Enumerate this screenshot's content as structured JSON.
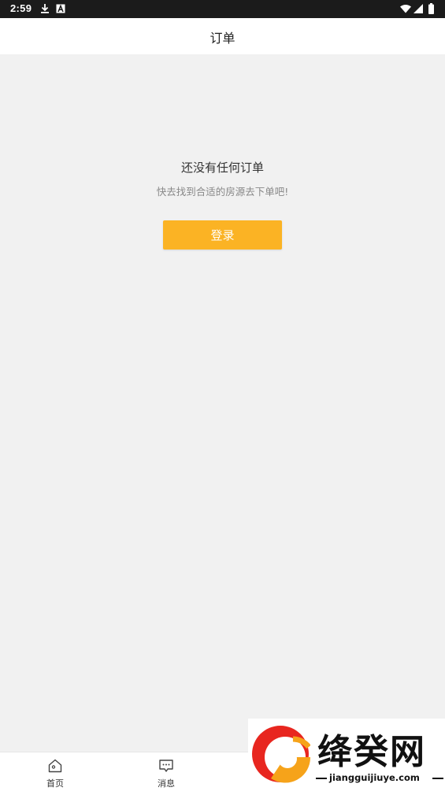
{
  "status_bar": {
    "time": "2:59",
    "left_icons": [
      "download-icon",
      "a-badge-icon"
    ],
    "right_icons": [
      "wifi-icon",
      "signal-icon",
      "battery-icon"
    ]
  },
  "header": {
    "title": "订单"
  },
  "empty_state": {
    "title": "还没有任何订单",
    "subtitle": "快去找到合适的房源去下单吧!",
    "login_label": "登录"
  },
  "tab_bar": {
    "tabs": [
      {
        "label": "首页",
        "icon": "home-icon"
      },
      {
        "label": "消息",
        "icon": "message-icon"
      }
    ]
  },
  "watermark": {
    "brand": "绛癸网",
    "domain": "jiangguijiuye.com"
  },
  "colors": {
    "accent": "#fbb324",
    "background": "#f1f1f1",
    "status_bar": "#1b1b1b"
  }
}
